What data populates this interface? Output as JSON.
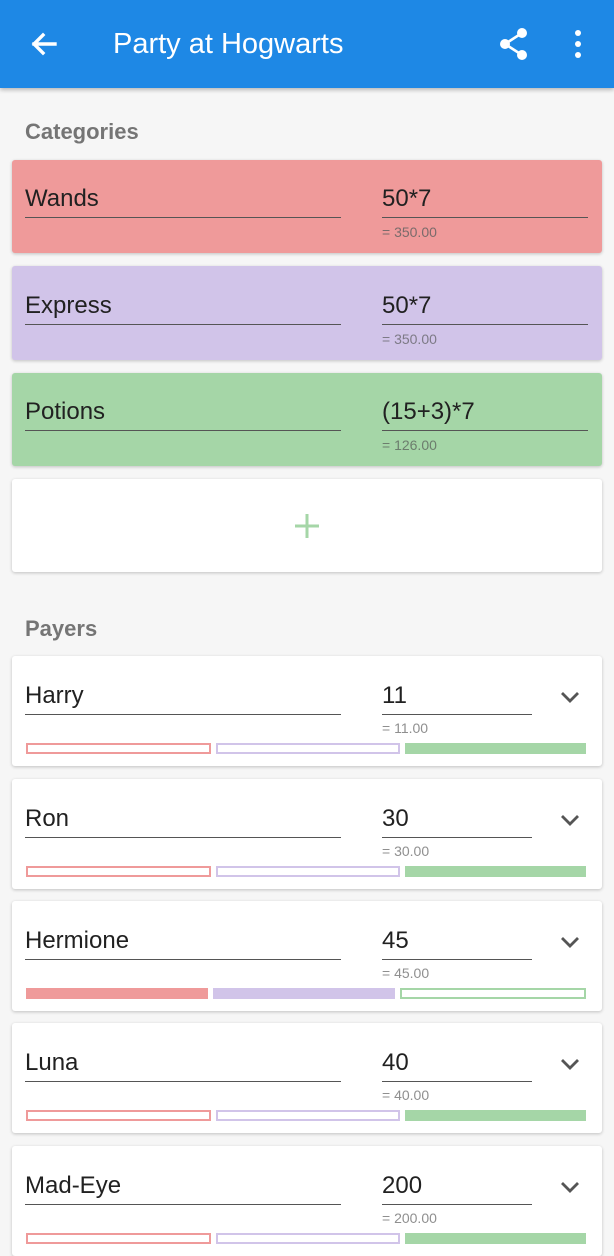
{
  "app": {
    "title": "Party at Hogwarts"
  },
  "icons": {
    "back": "arrow-back-icon",
    "share": "share-icon",
    "more": "more-vert-icon",
    "add": "add-icon",
    "expand": "chevron-down-icon"
  },
  "colors": {
    "appbar": "#1e88e5",
    "wands": "#ef9a9a",
    "express": "#d1c4e9",
    "potions": "#a5d6a7"
  },
  "categories": {
    "label": "Categories",
    "items": [
      {
        "name": "Wands",
        "amount": "50*7",
        "result": "= 350.00"
      },
      {
        "name": "Express",
        "amount": "50*7",
        "result": "= 350.00"
      },
      {
        "name": "Potions",
        "amount": "(15+3)*7",
        "result": "= 126.00"
      }
    ],
    "add_label": "+"
  },
  "payers": {
    "label": "Payers",
    "items": [
      {
        "name": "Harry",
        "amount": "11",
        "result": "= 11.00",
        "shares": [
          false,
          false,
          true
        ]
      },
      {
        "name": "Ron",
        "amount": "30",
        "result": "= 30.00",
        "shares": [
          false,
          false,
          true
        ]
      },
      {
        "name": "Hermione",
        "amount": "45",
        "result": "= 45.00",
        "shares": [
          true,
          true,
          false
        ]
      },
      {
        "name": "Luna",
        "amount": "40",
        "result": "= 40.00",
        "shares": [
          false,
          false,
          true
        ]
      },
      {
        "name": "Mad-Eye",
        "amount": "200",
        "result": "= 200.00",
        "shares": [
          false,
          false,
          true
        ]
      }
    ]
  }
}
